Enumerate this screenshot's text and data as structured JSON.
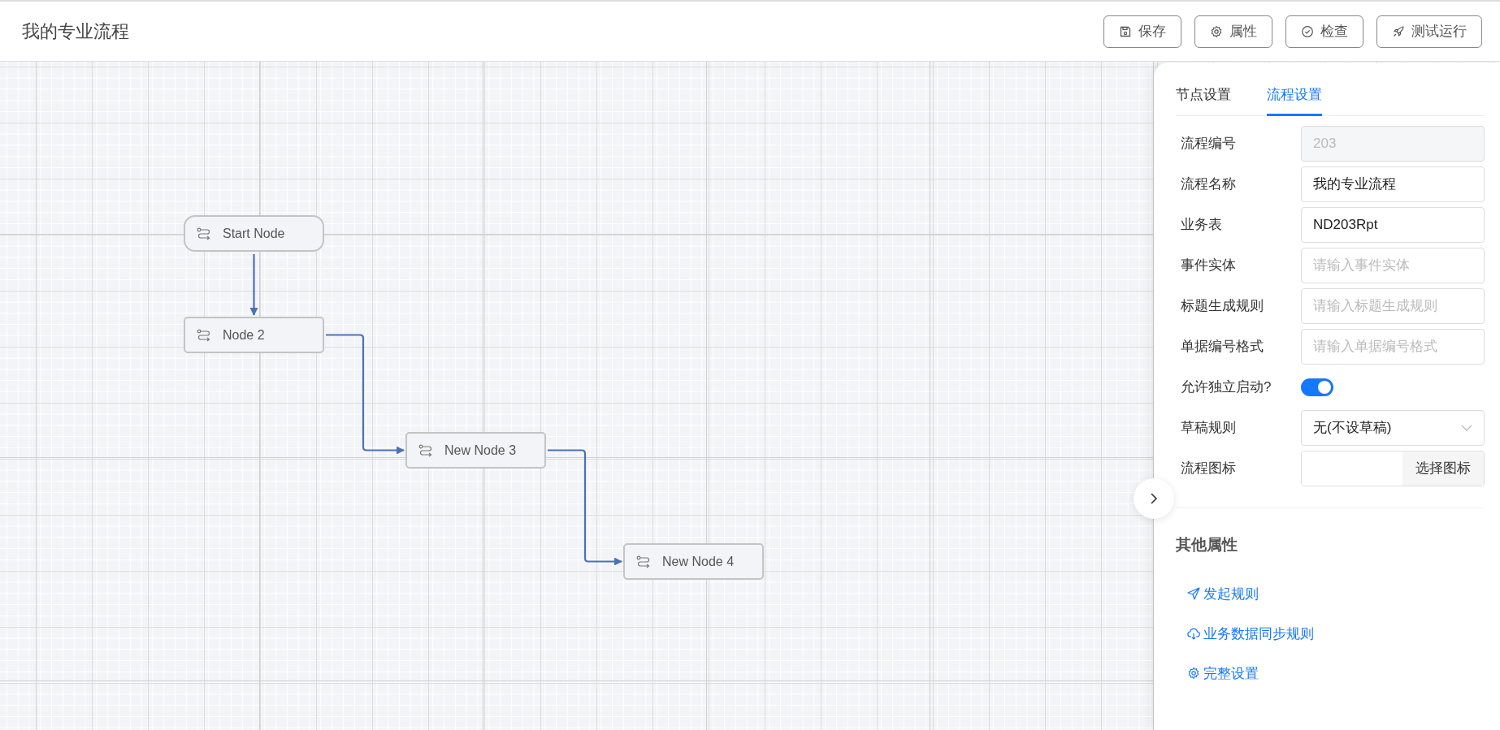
{
  "header": {
    "title": "我的专业流程",
    "buttons": [
      "保存",
      "属性",
      "检查",
      "测试运行"
    ]
  },
  "canvas": {
    "nodes": [
      {
        "label": "Start Node",
        "kind": "start"
      },
      {
        "label": "Node 2",
        "kind": "task"
      },
      {
        "label": "New Node 3",
        "kind": "task"
      },
      {
        "label": "New Node 4",
        "kind": "task"
      }
    ]
  },
  "panel": {
    "tabs": [
      {
        "label": "节点设置",
        "selected": false
      },
      {
        "label": "流程设置",
        "selected": true
      }
    ],
    "fields": [
      {
        "label": "流程编号",
        "kind": "text",
        "value": "203",
        "disabled": true
      },
      {
        "label": "流程名称",
        "kind": "text",
        "value": "我的专业流程"
      },
      {
        "label": "业务表",
        "kind": "text",
        "value": "ND203Rpt"
      },
      {
        "label": "事件实体",
        "kind": "text",
        "placeholder": "请输入事件实体"
      },
      {
        "label": "标题生成规则",
        "kind": "text",
        "placeholder": "请输入标题生成规则"
      },
      {
        "label": "单据编号格式",
        "kind": "text",
        "placeholder": "请输入单据编号格式"
      },
      {
        "label": "允许独立启动?",
        "kind": "toggle",
        "on": true
      },
      {
        "label": "草稿规则",
        "kind": "select",
        "value": "无(不设草稿)"
      },
      {
        "label": "流程图标",
        "kind": "picker",
        "button": "选择图标"
      }
    ],
    "section_title": "其他属性",
    "links": [
      "发起规则",
      "业务数据同步规则",
      "完整设置"
    ]
  }
}
